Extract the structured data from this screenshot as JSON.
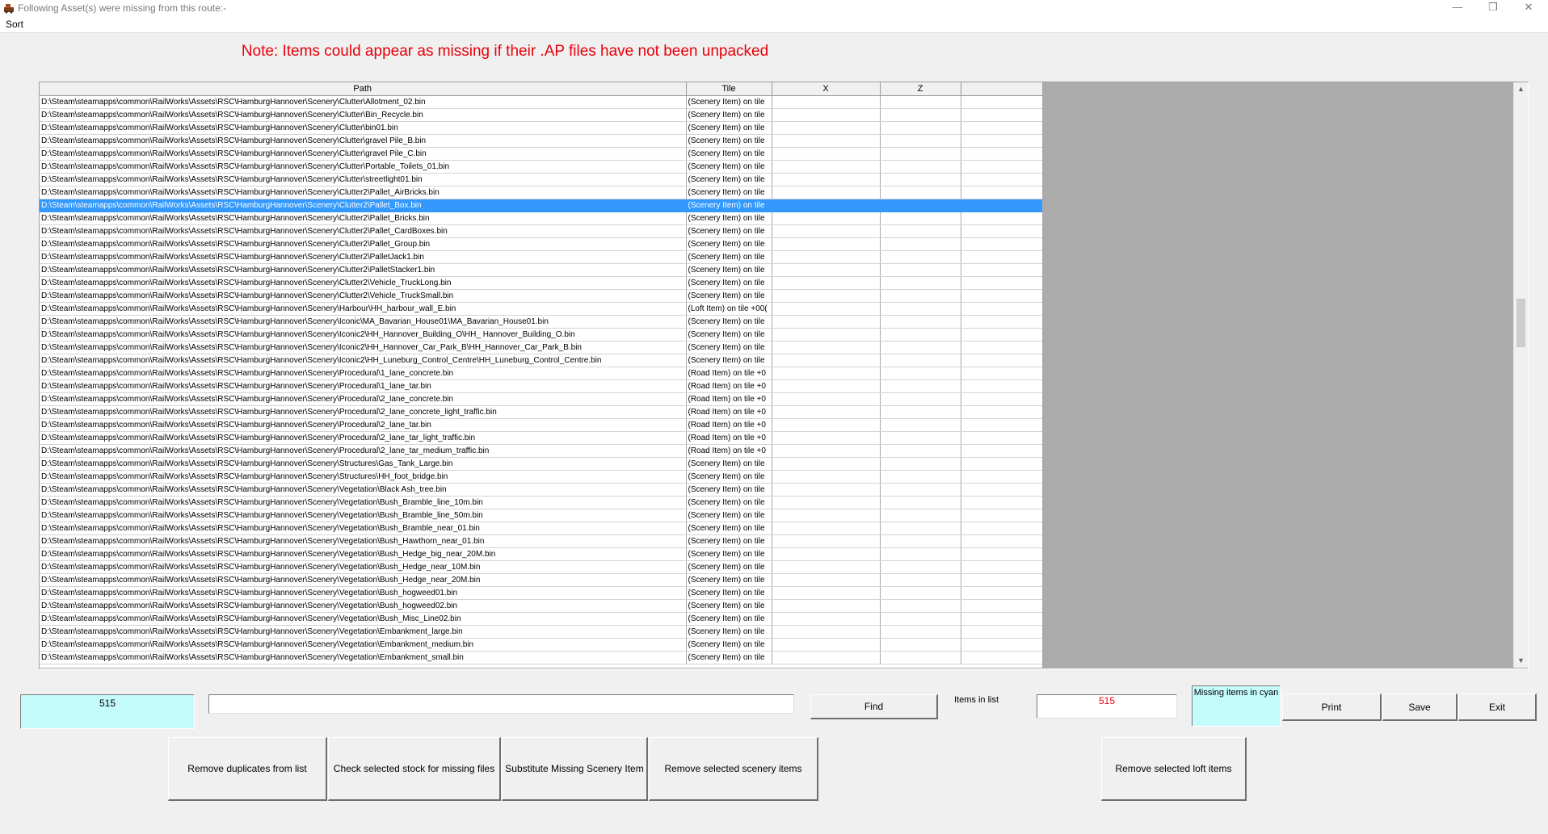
{
  "window": {
    "title": "Following Asset(s) were missing from this route:-",
    "minimize": "—",
    "restore": "❐",
    "close": "✕"
  },
  "menu": {
    "sort": "Sort"
  },
  "note": "Note: Items could appear as missing if their .AP files have not been unpacked",
  "table": {
    "columns": [
      "Path",
      "Tile",
      "X",
      "Z",
      ""
    ],
    "selected_row": 8,
    "rows": [
      {
        "path": "D:\\Steam\\steamapps\\common\\RailWorks\\Assets\\RSC\\HamburgHannover\\Scenery\\Clutter\\Allotment_02.bin",
        "tile": "(Scenery Item) on tile"
      },
      {
        "path": "D:\\Steam\\steamapps\\common\\RailWorks\\Assets\\RSC\\HamburgHannover\\Scenery\\Clutter\\Bin_Recycle.bin",
        "tile": "(Scenery Item) on tile"
      },
      {
        "path": "D:\\Steam\\steamapps\\common\\RailWorks\\Assets\\RSC\\HamburgHannover\\Scenery\\Clutter\\bin01.bin",
        "tile": "(Scenery Item) on tile"
      },
      {
        "path": "D:\\Steam\\steamapps\\common\\RailWorks\\Assets\\RSC\\HamburgHannover\\Scenery\\Clutter\\gravel Pile_B.bin",
        "tile": "(Scenery Item) on tile"
      },
      {
        "path": "D:\\Steam\\steamapps\\common\\RailWorks\\Assets\\RSC\\HamburgHannover\\Scenery\\Clutter\\gravel Pile_C.bin",
        "tile": "(Scenery Item) on tile"
      },
      {
        "path": "D:\\Steam\\steamapps\\common\\RailWorks\\Assets\\RSC\\HamburgHannover\\Scenery\\Clutter\\Portable_Toilets_01.bin",
        "tile": "(Scenery Item) on tile"
      },
      {
        "path": "D:\\Steam\\steamapps\\common\\RailWorks\\Assets\\RSC\\HamburgHannover\\Scenery\\Clutter\\streetlight01.bin",
        "tile": "(Scenery Item) on tile"
      },
      {
        "path": "D:\\Steam\\steamapps\\common\\RailWorks\\Assets\\RSC\\HamburgHannover\\Scenery\\Clutter2\\Pallet_AirBricks.bin",
        "tile": "(Scenery Item) on tile"
      },
      {
        "path": "D:\\Steam\\steamapps\\common\\RailWorks\\Assets\\RSC\\HamburgHannover\\Scenery\\Clutter2\\Pallet_Box.bin",
        "tile": "(Scenery Item) on tile"
      },
      {
        "path": "D:\\Steam\\steamapps\\common\\RailWorks\\Assets\\RSC\\HamburgHannover\\Scenery\\Clutter2\\Pallet_Bricks.bin",
        "tile": "(Scenery Item) on tile"
      },
      {
        "path": "D:\\Steam\\steamapps\\common\\RailWorks\\Assets\\RSC\\HamburgHannover\\Scenery\\Clutter2\\Pallet_CardBoxes.bin",
        "tile": "(Scenery Item) on tile"
      },
      {
        "path": "D:\\Steam\\steamapps\\common\\RailWorks\\Assets\\RSC\\HamburgHannover\\Scenery\\Clutter2\\Pallet_Group.bin",
        "tile": "(Scenery Item) on tile"
      },
      {
        "path": "D:\\Steam\\steamapps\\common\\RailWorks\\Assets\\RSC\\HamburgHannover\\Scenery\\Clutter2\\PalletJack1.bin",
        "tile": "(Scenery Item) on tile"
      },
      {
        "path": "D:\\Steam\\steamapps\\common\\RailWorks\\Assets\\RSC\\HamburgHannover\\Scenery\\Clutter2\\PalletStacker1.bin",
        "tile": "(Scenery Item) on tile"
      },
      {
        "path": "D:\\Steam\\steamapps\\common\\RailWorks\\Assets\\RSC\\HamburgHannover\\Scenery\\Clutter2\\Vehicle_TruckLong.bin",
        "tile": "(Scenery Item) on tile"
      },
      {
        "path": "D:\\Steam\\steamapps\\common\\RailWorks\\Assets\\RSC\\HamburgHannover\\Scenery\\Clutter2\\Vehicle_TruckSmall.bin",
        "tile": "(Scenery Item) on tile"
      },
      {
        "path": "D:\\Steam\\steamapps\\common\\RailWorks\\Assets\\RSC\\HamburgHannover\\Scenery\\Harbour\\HH_harbour_wall_E.bin",
        "tile": "(Loft Item) on tile +00("
      },
      {
        "path": "D:\\Steam\\steamapps\\common\\RailWorks\\Assets\\RSC\\HamburgHannover\\Scenery\\Iconic\\MA_Bavarian_House01\\MA_Bavarian_House01.bin",
        "tile": "(Scenery Item) on tile"
      },
      {
        "path": "D:\\Steam\\steamapps\\common\\RailWorks\\Assets\\RSC\\HamburgHannover\\Scenery\\Iconic2\\HH_Hannover_Building_O\\HH_ Hannover_Building_O.bin",
        "tile": "(Scenery Item) on tile"
      },
      {
        "path": "D:\\Steam\\steamapps\\common\\RailWorks\\Assets\\RSC\\HamburgHannover\\Scenery\\Iconic2\\HH_Hannover_Car_Park_B\\HH_Hannover_Car_Park_B.bin",
        "tile": "(Scenery Item) on tile"
      },
      {
        "path": "D:\\Steam\\steamapps\\common\\RailWorks\\Assets\\RSC\\HamburgHannover\\Scenery\\Iconic2\\HH_Luneburg_Control_Centre\\HH_Luneburg_Control_Centre.bin",
        "tile": "(Scenery Item) on tile"
      },
      {
        "path": "D:\\Steam\\steamapps\\common\\RailWorks\\Assets\\RSC\\HamburgHannover\\Scenery\\Procedural\\1_lane_concrete.bin",
        "tile": "(Road Item) on tile +0"
      },
      {
        "path": "D:\\Steam\\steamapps\\common\\RailWorks\\Assets\\RSC\\HamburgHannover\\Scenery\\Procedural\\1_lane_tar.bin",
        "tile": "(Road Item) on tile +0"
      },
      {
        "path": "D:\\Steam\\steamapps\\common\\RailWorks\\Assets\\RSC\\HamburgHannover\\Scenery\\Procedural\\2_lane_concrete.bin",
        "tile": "(Road Item) on tile +0"
      },
      {
        "path": "D:\\Steam\\steamapps\\common\\RailWorks\\Assets\\RSC\\HamburgHannover\\Scenery\\Procedural\\2_lane_concrete_light_traffic.bin",
        "tile": "(Road Item) on tile +0"
      },
      {
        "path": "D:\\Steam\\steamapps\\common\\RailWorks\\Assets\\RSC\\HamburgHannover\\Scenery\\Procedural\\2_lane_tar.bin",
        "tile": "(Road Item) on tile +0"
      },
      {
        "path": "D:\\Steam\\steamapps\\common\\RailWorks\\Assets\\RSC\\HamburgHannover\\Scenery\\Procedural\\2_lane_tar_light_traffic.bin",
        "tile": "(Road Item) on tile +0"
      },
      {
        "path": "D:\\Steam\\steamapps\\common\\RailWorks\\Assets\\RSC\\HamburgHannover\\Scenery\\Procedural\\2_lane_tar_medium_traffic.bin",
        "tile": "(Road Item) on tile +0"
      },
      {
        "path": "D:\\Steam\\steamapps\\common\\RailWorks\\Assets\\RSC\\HamburgHannover\\Scenery\\Structures\\Gas_Tank_Large.bin",
        "tile": "(Scenery Item) on tile"
      },
      {
        "path": "D:\\Steam\\steamapps\\common\\RailWorks\\Assets\\RSC\\HamburgHannover\\Scenery\\Structures\\HH_foot_bridge.bin",
        "tile": "(Scenery Item) on tile"
      },
      {
        "path": "D:\\Steam\\steamapps\\common\\RailWorks\\Assets\\RSC\\HamburgHannover\\Scenery\\Vegetation\\Black Ash_tree.bin",
        "tile": "(Scenery Item) on tile"
      },
      {
        "path": "D:\\Steam\\steamapps\\common\\RailWorks\\Assets\\RSC\\HamburgHannover\\Scenery\\Vegetation\\Bush_Bramble_line_10m.bin",
        "tile": "(Scenery Item) on tile"
      },
      {
        "path": "D:\\Steam\\steamapps\\common\\RailWorks\\Assets\\RSC\\HamburgHannover\\Scenery\\Vegetation\\Bush_Bramble_line_50m.bin",
        "tile": "(Scenery Item) on tile"
      },
      {
        "path": "D:\\Steam\\steamapps\\common\\RailWorks\\Assets\\RSC\\HamburgHannover\\Scenery\\Vegetation\\Bush_Bramble_near_01.bin",
        "tile": "(Scenery Item) on tile"
      },
      {
        "path": "D:\\Steam\\steamapps\\common\\RailWorks\\Assets\\RSC\\HamburgHannover\\Scenery\\Vegetation\\Bush_Hawthorn_near_01.bin",
        "tile": "(Scenery Item) on tile"
      },
      {
        "path": "D:\\Steam\\steamapps\\common\\RailWorks\\Assets\\RSC\\HamburgHannover\\Scenery\\Vegetation\\Bush_Hedge_big_near_20M.bin",
        "tile": "(Scenery Item) on tile"
      },
      {
        "path": "D:\\Steam\\steamapps\\common\\RailWorks\\Assets\\RSC\\HamburgHannover\\Scenery\\Vegetation\\Bush_Hedge_near_10M.bin",
        "tile": "(Scenery Item) on tile"
      },
      {
        "path": "D:\\Steam\\steamapps\\common\\RailWorks\\Assets\\RSC\\HamburgHannover\\Scenery\\Vegetation\\Bush_Hedge_near_20M.bin",
        "tile": "(Scenery Item) on tile"
      },
      {
        "path": "D:\\Steam\\steamapps\\common\\RailWorks\\Assets\\RSC\\HamburgHannover\\Scenery\\Vegetation\\Bush_hogweed01.bin",
        "tile": "(Scenery Item) on tile"
      },
      {
        "path": "D:\\Steam\\steamapps\\common\\RailWorks\\Assets\\RSC\\HamburgHannover\\Scenery\\Vegetation\\Bush_hogweed02.bin",
        "tile": "(Scenery Item) on tile"
      },
      {
        "path": "D:\\Steam\\steamapps\\common\\RailWorks\\Assets\\RSC\\HamburgHannover\\Scenery\\Vegetation\\Bush_Misc_Line02.bin",
        "tile": "(Scenery Item) on tile"
      },
      {
        "path": "D:\\Steam\\steamapps\\common\\RailWorks\\Assets\\RSC\\HamburgHannover\\Scenery\\Vegetation\\Embankment_large.bin",
        "tile": "(Scenery Item) on tile"
      },
      {
        "path": "D:\\Steam\\steamapps\\common\\RailWorks\\Assets\\RSC\\HamburgHannover\\Scenery\\Vegetation\\Embankment_medium.bin",
        "tile": "(Scenery Item) on tile"
      },
      {
        "path": "D:\\Steam\\steamapps\\common\\RailWorks\\Assets\\RSC\\HamburgHannover\\Scenery\\Vegetation\\Embankment_small.bin",
        "tile": "(Scenery Item) on tile"
      }
    ]
  },
  "scrollbar": {
    "up_arrow": "▲",
    "down_arrow": "▼"
  },
  "bottom": {
    "count_value": "515",
    "find_input_value": "",
    "find_label": "Find",
    "items_in_list_label": "Items in list",
    "items_in_list_value": "515",
    "missing_cyan_label": "Missing items in cyan",
    "print_label": "Print",
    "save_label": "Save",
    "exit_label": "Exit",
    "remove_duplicates_label": "Remove duplicates from list",
    "check_stock_label": "Check selected stock for missing files",
    "substitute_label": "Substitute Missing Scenery Item",
    "remove_scenery_label": "Remove selected scenery items",
    "remove_loft_label": "Remove selected loft items"
  },
  "colors": {
    "note_red": "#e8000b",
    "cyan": "#c4fbfb",
    "selection": "#3399ff"
  }
}
